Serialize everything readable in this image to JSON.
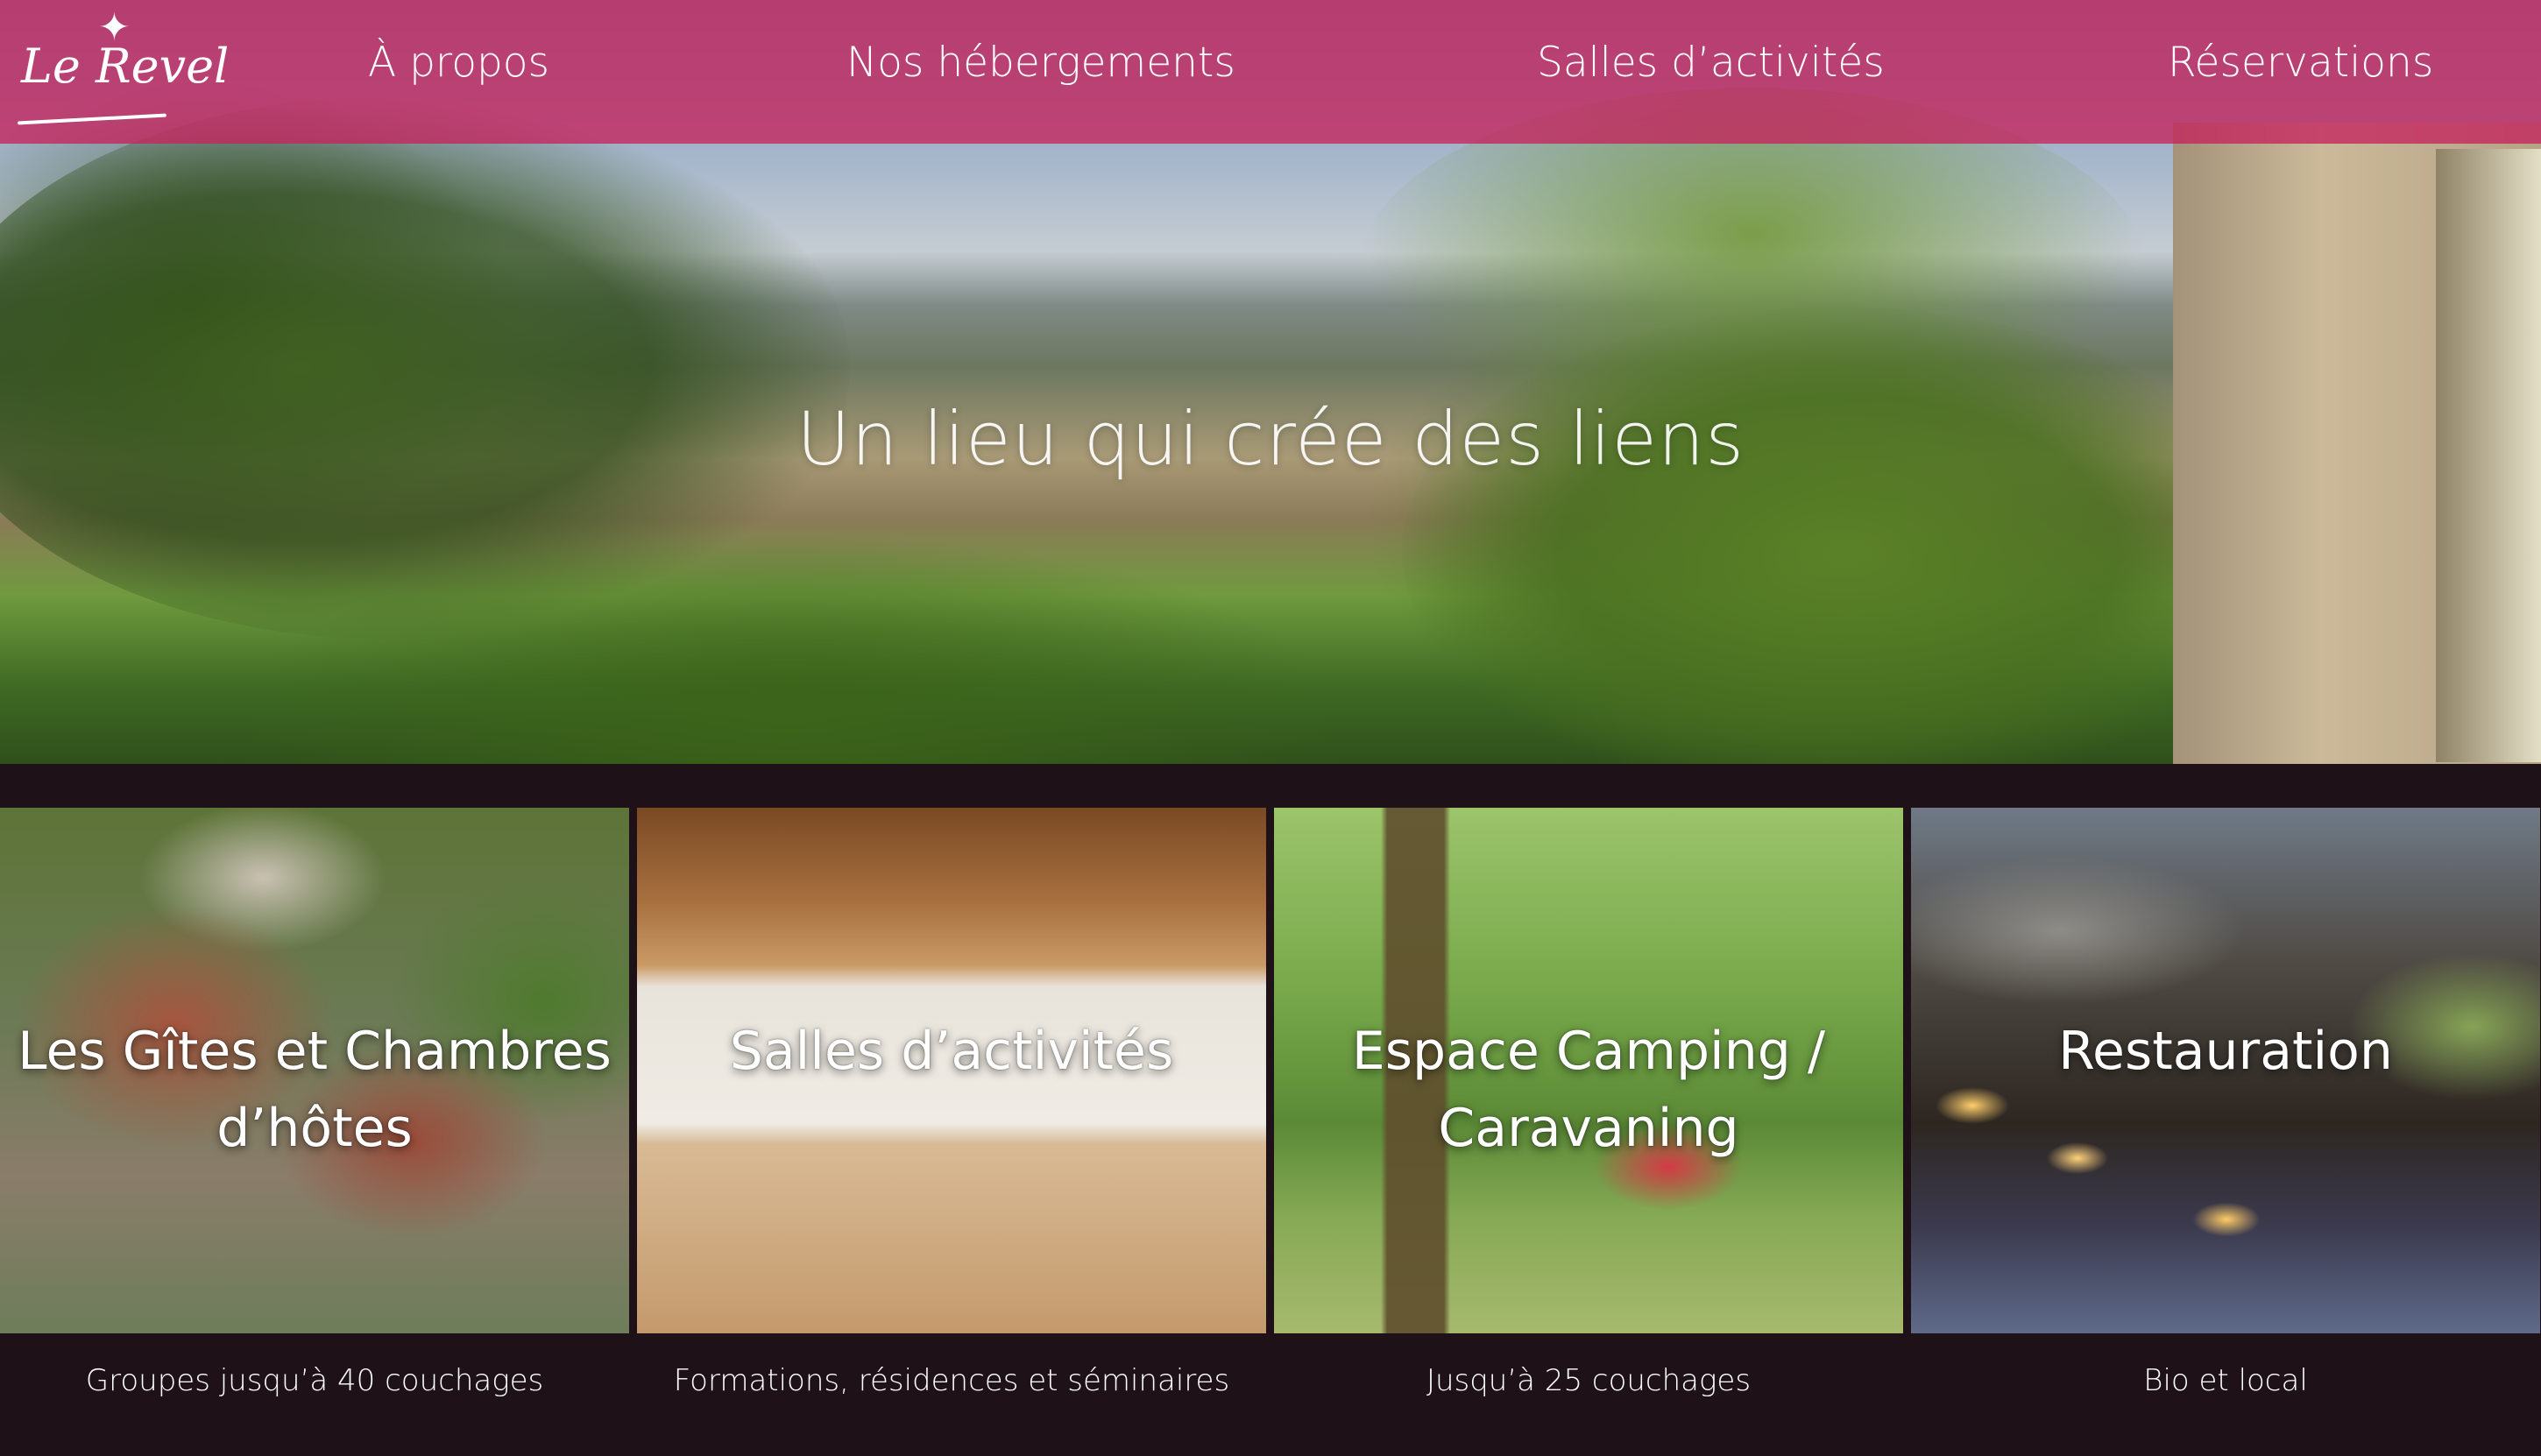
{
  "brand": {
    "logo_text": "Le Revel",
    "logo_star": "✦"
  },
  "nav": {
    "items": [
      {
        "label": "À propos"
      },
      {
        "label": "Nos hébergements"
      },
      {
        "label": "Salles d’activités"
      },
      {
        "label": "Réservations"
      }
    ]
  },
  "hero": {
    "title": "Un lieu qui crée des liens"
  },
  "cards": [
    {
      "title": "Les Gîtes et Chambres d’hôtes",
      "caption": "Groupes jusqu’à 40 couchages"
    },
    {
      "title": "Salles d’activités",
      "caption": "Formations, résidences et séminaires"
    },
    {
      "title": "Espace Camping / Caravaning",
      "caption": "Jusqu’à 25 couchages"
    },
    {
      "title": "Restauration",
      "caption": "Bio et local"
    }
  ],
  "colors": {
    "nav_background": "#c4245c",
    "footer_background": "#1e1117",
    "text": "#ffffff"
  }
}
